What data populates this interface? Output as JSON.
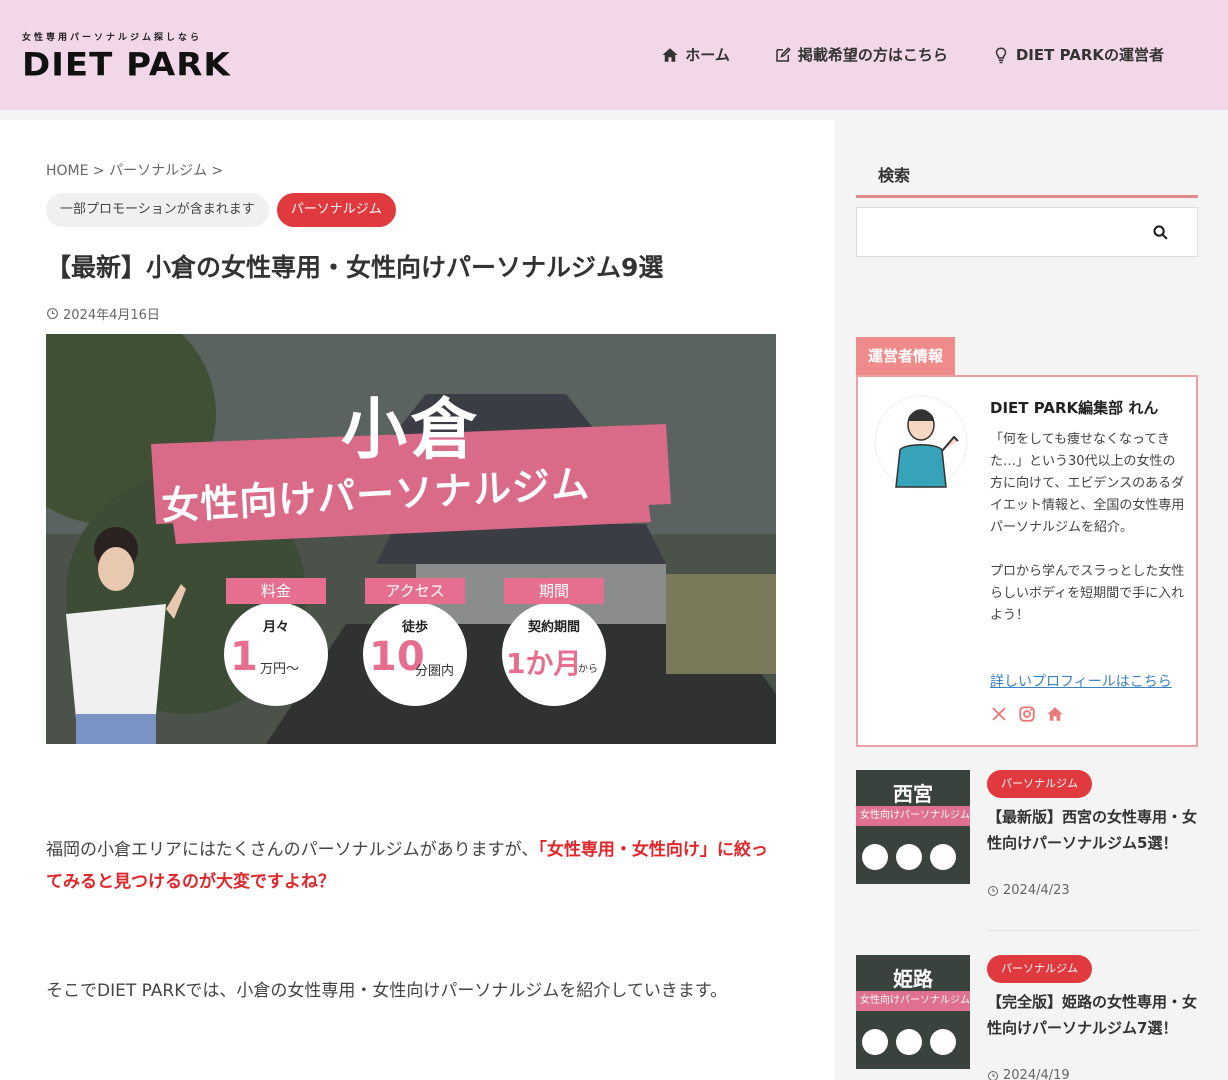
{
  "header": {
    "logo_tagline": "女性専用パーソナルジム探しなら",
    "logo_text": "DIET PARK",
    "nav": [
      {
        "label": "ホーム",
        "icon": "home-icon"
      },
      {
        "label": "掲載希望の方はこちら",
        "icon": "edit-icon"
      },
      {
        "label": "DIET PARKの運営者",
        "icon": "lightbulb-icon"
      }
    ],
    "background": "#f1d7e8"
  },
  "article": {
    "breadcrumb": "HOME > パーソナルジム >",
    "promo_pill": "一部プロモーションが含まれます",
    "category_pill": "パーソナルジム",
    "title": "【最新】小倉の女性専用・女性向けパーソナルジム9選",
    "date": "2024年4月16日",
    "hero": {
      "city": "小倉",
      "subtitle": "女性向けパーソナルジム",
      "badges": [
        {
          "label": "料金",
          "top": "月々",
          "big": "1",
          "small": "万円〜"
        },
        {
          "label": "アクセス",
          "top": "徒歩",
          "big": "10",
          "small": "分圏内"
        },
        {
          "label": "期間",
          "top": "契約期間",
          "big": "1か月",
          "small": "から"
        }
      ]
    },
    "para1_plain": "福岡の小倉エリアにはたくさんのパーソナルジムがありますが、",
    "para1_highlight": "「女性専用・女性向け」に絞ってみると見つけるのが大変ですよね？",
    "para2": "そこでDIET PARKでは、小倉の女性専用・女性向けパーソナルジムを紹介していきます。"
  },
  "sidebar": {
    "search_title": "検索",
    "search_placeholder": "",
    "operator": {
      "tab": "運営者情報",
      "name": "DIET PARK編集部 れん",
      "desc1": "「何をしても痩せなくなってきた…」という30代以上の女性の方に向けて、エビデンスのあるダイエット情報と、全国の女性専用パーソナルジムを紹介。",
      "desc2": "プロから学んでスラっとした女性らしいボディを短期間で手に入れよう！",
      "link": "詳しいプロフィールはこちら"
    },
    "posts": [
      {
        "thumb_city": "西宮",
        "thumb_band": "女性向けパーソナルジム",
        "category": "パーソナルジム",
        "title": "【最新版】西宮の女性専用・女性向けパーソナルジム5選！",
        "date": "2024/4/23"
      },
      {
        "thumb_city": "姫路",
        "thumb_band": "女性向けパーソナルジム",
        "category": "パーソナルジム",
        "title": "【完全版】姫路の女性専用・女性向けパーソナルジム7選！",
        "date": "2024/4/19"
      }
    ]
  },
  "colors": {
    "accent": "#e0393e",
    "pink": "#e66f90",
    "link": "#3b82c4"
  }
}
